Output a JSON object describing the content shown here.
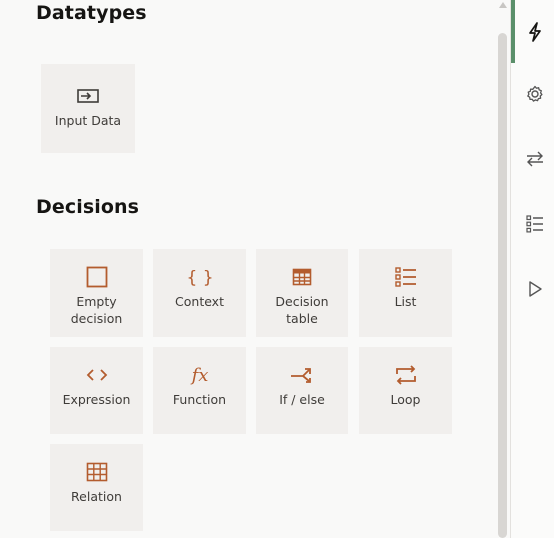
{
  "sections": {
    "datatypes_title": "Datatypes",
    "decisions_title": "Decisions"
  },
  "datatypes": {
    "input_data": {
      "label": "Input Data",
      "icon": "input-data-icon"
    }
  },
  "decisions": {
    "items": [
      {
        "label": "Empty\ndecision",
        "icon": "empty-decision-icon"
      },
      {
        "label": "Context",
        "icon": "context-braces-icon"
      },
      {
        "label": "Decision\ntable",
        "icon": "decision-table-icon"
      },
      {
        "label": "List",
        "icon": "list-icon"
      },
      {
        "label": "Expression",
        "icon": "expression-icon"
      },
      {
        "label": "Function",
        "icon": "function-icon"
      },
      {
        "label": "If / else",
        "icon": "if-else-icon"
      },
      {
        "label": "Loop",
        "icon": "loop-icon"
      },
      {
        "label": "Relation",
        "icon": "relation-table-icon"
      }
    ]
  },
  "rail": {
    "items": [
      "lightning-icon",
      "settings-gear-icon",
      "swap-arrows-icon",
      "checklist-icon",
      "play-icon"
    ],
    "active": "lightning-icon"
  },
  "colors": {
    "accent": "#b35c2e",
    "tile_bg": "#f1efed",
    "active_indicator": "#5b8f6a"
  }
}
